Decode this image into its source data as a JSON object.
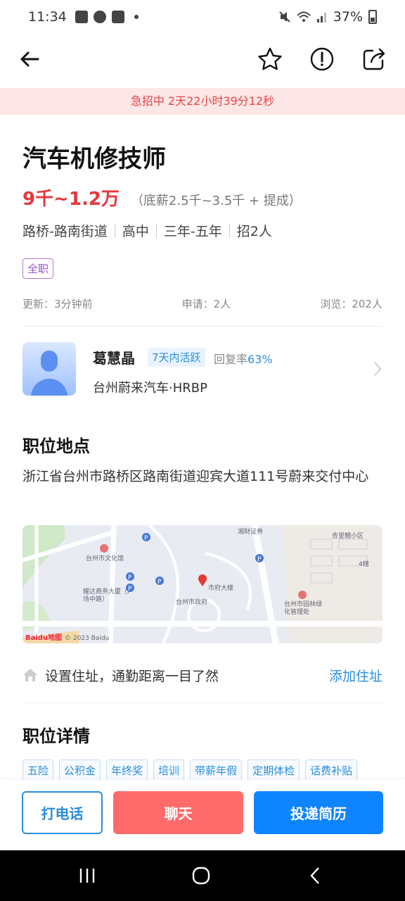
{
  "status_bar": {
    "time": "11:34",
    "battery": "37%"
  },
  "nav": {
    "back_icon": "back-arrow-icon",
    "favorite_icon": "star-icon",
    "report_icon": "alert-icon",
    "share_icon": "share-icon"
  },
  "urgent": {
    "text": "急招中 2天22小时39分12秒"
  },
  "job": {
    "title": "汽车机修技师",
    "salary": "9千~1.2万",
    "salary_note": "（底薪2.5千~3.5千 + 提成）",
    "tags": [
      "路桥-路南街道",
      "高中",
      "三年-五年",
      "招2人"
    ],
    "type": "全职",
    "updated": "更新：3分钟前",
    "applications": "申请：2人",
    "views": "浏览：202人"
  },
  "recruiter": {
    "name": "葛慧晶",
    "active": "7天内活跃",
    "reply_label": "回复率",
    "reply_rate": "63%",
    "company": "台州蔚来汽车·HRBP"
  },
  "location": {
    "title": "职位地点",
    "address": "浙江省台州市路桥区路南街道迎宾大道111号蔚来交付中心",
    "map_labels": [
      "湘财证券",
      "台州市文化馆",
      "耀达商务大厦（广场中路）",
      "市府大楼",
      "台州市政府",
      "杏里鲤小区",
      "4幢",
      "台州市园林绿化管理处"
    ],
    "map_logo": "Baidu地图",
    "map_copyright": "© 2023 Baidu",
    "home_text": "设置住址，通勤距离一目了然",
    "add_address": "添加住址"
  },
  "details": {
    "title": "职位详情",
    "benefits": [
      "五险",
      "公积金",
      "年终奖",
      "培训",
      "带薪年假",
      "定期体检",
      "话费补贴"
    ]
  },
  "actions": {
    "call": "打电话",
    "chat": "聊天",
    "apply": "投递简历"
  },
  "colors": {
    "accent_blue": "#2a8ddc",
    "salary_red": "#e5383b",
    "chat_red": "#ff6b6b",
    "apply_blue": "#0f84ff"
  }
}
